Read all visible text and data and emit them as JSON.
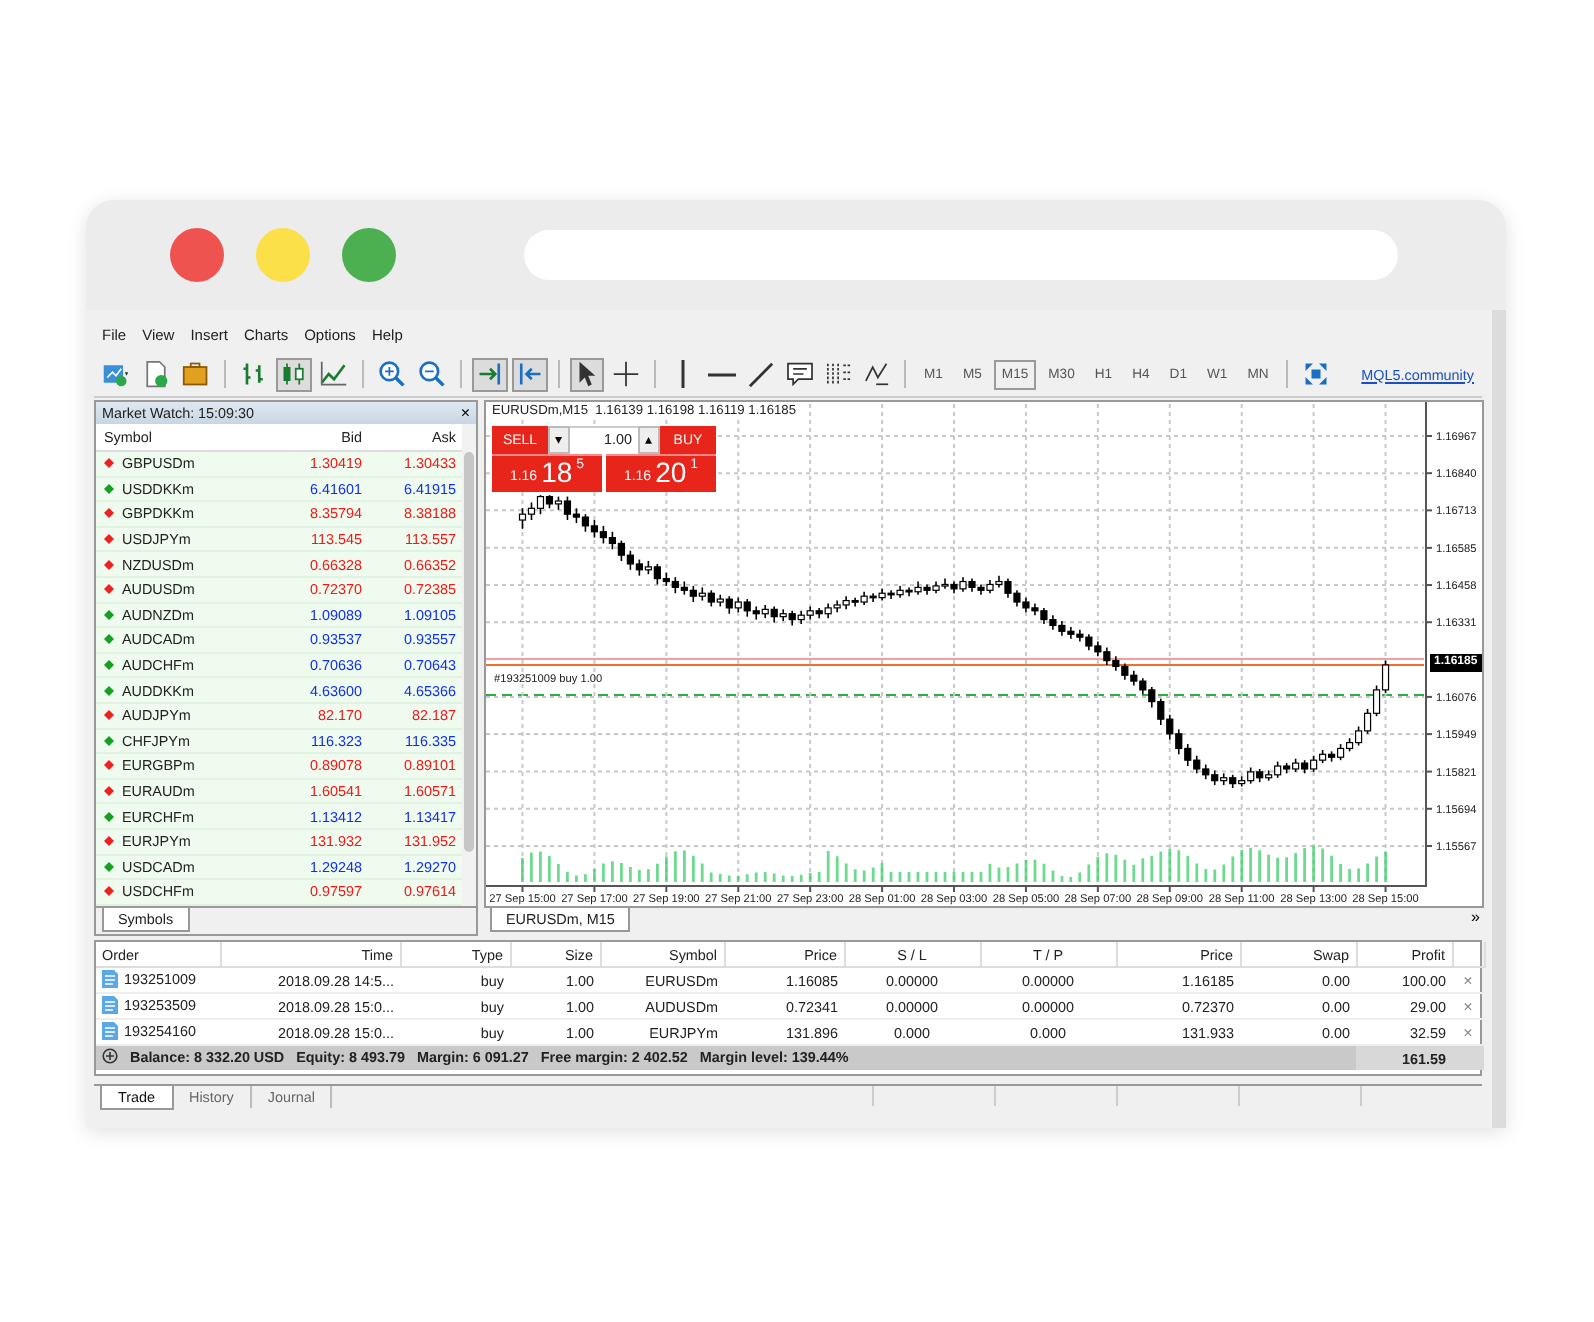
{
  "menu": [
    "File",
    "View",
    "Insert",
    "Charts",
    "Options",
    "Help"
  ],
  "toolbar": {
    "tool_groups": [
      [
        {
          "kind": "new-chart",
          "pressed": false
        },
        {
          "kind": "new-doc",
          "pressed": false
        },
        {
          "kind": "briefcase",
          "pressed": false
        }
      ],
      [
        {
          "kind": "bars",
          "pressed": false
        },
        {
          "kind": "candles",
          "pressed": true
        },
        {
          "kind": "line",
          "pressed": false
        }
      ],
      [
        {
          "kind": "zoom-in",
          "pressed": false
        },
        {
          "kind": "zoom-out",
          "pressed": false
        }
      ],
      [
        {
          "kind": "autoscroll",
          "pressed": true
        },
        {
          "kind": "shift",
          "pressed": true
        }
      ],
      [
        {
          "kind": "cursor",
          "pressed": true
        },
        {
          "kind": "crosshair",
          "pressed": false
        }
      ],
      [
        {
          "kind": "vline",
          "pressed": false
        },
        {
          "kind": "hline",
          "pressed": false
        },
        {
          "kind": "trendline",
          "pressed": false
        },
        {
          "kind": "text",
          "pressed": false
        },
        {
          "kind": "fibo",
          "pressed": false
        },
        {
          "kind": "indicators",
          "pressed": false
        }
      ]
    ],
    "timeframes": [
      {
        "label": "M1",
        "selected": false
      },
      {
        "label": "M5",
        "selected": false
      },
      {
        "label": "M15",
        "selected": true
      },
      {
        "label": "M30",
        "selected": false
      },
      {
        "label": "H1",
        "selected": false
      },
      {
        "label": "H4",
        "selected": false
      },
      {
        "label": "D1",
        "selected": false
      },
      {
        "label": "W1",
        "selected": false
      },
      {
        "label": "MN",
        "selected": false
      }
    ],
    "link": "MQL5.community"
  },
  "market_watch": {
    "title": "Market Watch: 15:09:30",
    "close": "×",
    "columns": [
      "Symbol",
      "Bid",
      "Ask"
    ],
    "rows": [
      {
        "symbol": "GBPUSDm",
        "bid": "1.30419",
        "ask": "1.30433",
        "rising": false
      },
      {
        "symbol": "USDDKKm",
        "bid": "6.41601",
        "ask": "6.41915",
        "rising": true
      },
      {
        "symbol": "GBPDKKm",
        "bid": "8.35794",
        "ask": "8.38188",
        "rising": false
      },
      {
        "symbol": "USDJPYm",
        "bid": "113.545",
        "ask": "113.557",
        "rising": false
      },
      {
        "symbol": "NZDUSDm",
        "bid": "0.66328",
        "ask": "0.66352",
        "rising": false
      },
      {
        "symbol": "AUDUSDm",
        "bid": "0.72370",
        "ask": "0.72385",
        "rising": false
      },
      {
        "symbol": "AUDNZDm",
        "bid": "1.09089",
        "ask": "1.09105",
        "rising": true
      },
      {
        "symbol": "AUDCADm",
        "bid": "0.93537",
        "ask": "0.93557",
        "rising": true
      },
      {
        "symbol": "AUDCHFm",
        "bid": "0.70636",
        "ask": "0.70643",
        "rising": true
      },
      {
        "symbol": "AUDDKKm",
        "bid": "4.63600",
        "ask": "4.65366",
        "rising": true
      },
      {
        "symbol": "AUDJPYm",
        "bid": "82.170",
        "ask": "82.187",
        "rising": false
      },
      {
        "symbol": "CHFJPYm",
        "bid": "116.323",
        "ask": "116.335",
        "rising": true
      },
      {
        "symbol": "EURGBPm",
        "bid": "0.89078",
        "ask": "0.89101",
        "rising": false
      },
      {
        "symbol": "EURAUDm",
        "bid": "1.60541",
        "ask": "1.60571",
        "rising": false
      },
      {
        "symbol": "EURCHFm",
        "bid": "1.13412",
        "ask": "1.13417",
        "rising": true
      },
      {
        "symbol": "EURJPYm",
        "bid": "131.932",
        "ask": "131.952",
        "rising": false
      },
      {
        "symbol": "USDCADm",
        "bid": "1.29248",
        "ask": "1.29270",
        "rising": true
      },
      {
        "symbol": "USDCHFm",
        "bid": "0.97597",
        "ask": "0.97614",
        "rising": false
      }
    ],
    "tab": "Symbols"
  },
  "chart": {
    "header": "EURUSDm,M15  1.16139 1.16198 1.16119 1.16185",
    "trade_panel": {
      "sell": "SELL",
      "buy": "BUY",
      "down": "▾",
      "up": "▴",
      "volume": "1.00",
      "sell_price": {
        "base": "1.16",
        "big": "18",
        "small": "5"
      },
      "buy_price": {
        "base": "1.16",
        "big": "20",
        "small": "1"
      }
    },
    "current_price": "1.16185",
    "chart_data": {
      "type": "candlestick",
      "categories": [
        "27 Sep 15:00",
        null,
        null,
        null,
        null,
        null,
        null,
        null,
        "27 Sep 17:00",
        null,
        null,
        null,
        null,
        null,
        null,
        null,
        "27 Sep 19:00",
        null,
        null,
        null,
        null,
        null,
        null,
        null,
        "27 Sep 21:00",
        null,
        null,
        null,
        null,
        null,
        null,
        null,
        "27 Sep 23:00",
        null,
        null,
        null,
        null,
        null,
        null,
        null,
        "28 Sep 01:00",
        null,
        null,
        null,
        null,
        null,
        null,
        null,
        "28 Sep 03:00",
        null,
        null,
        null,
        null,
        null,
        null,
        null,
        "28 Sep 05:00",
        null,
        null,
        null,
        null,
        null,
        null,
        null,
        "28 Sep 07:00",
        null,
        null,
        null,
        null,
        null,
        null,
        null,
        "28 Sep 09:00",
        null,
        null,
        null,
        null,
        null,
        null,
        null,
        "28 Sep 11:00",
        null,
        null,
        null,
        null,
        null,
        null,
        null,
        "28 Sep 13:00",
        null,
        null,
        null,
        null,
        null,
        null,
        null,
        "28 Sep 15:00",
        null,
        null,
        null,
        null
      ],
      "ohlc": [
        [
          1.1668,
          1.1672,
          1.1665,
          1.167
        ],
        [
          1.167,
          1.1674,
          1.1668,
          1.1672
        ],
        [
          1.1672,
          1.16765,
          1.167,
          1.1676
        ],
        [
          1.1676,
          1.16765,
          1.1672,
          1.16735
        ],
        [
          1.16735,
          1.1676,
          1.16715,
          1.16745
        ],
        [
          1.16745,
          1.1676,
          1.1668,
          1.167
        ],
        [
          1.167,
          1.1672,
          1.1667,
          1.1669
        ],
        [
          1.1669,
          1.167,
          1.1664,
          1.1666
        ],
        [
          1.1666,
          1.1668,
          1.1662,
          1.1664
        ],
        [
          1.1664,
          1.1666,
          1.166,
          1.1662
        ],
        [
          1.1662,
          1.1664,
          1.1658,
          1.166
        ],
        [
          1.166,
          1.1661,
          1.1654,
          1.1656
        ],
        [
          1.1656,
          1.16575,
          1.1651,
          1.1653
        ],
        [
          1.1653,
          1.16545,
          1.1649,
          1.1651
        ],
        [
          1.1651,
          1.1654,
          1.16495,
          1.1652
        ],
        [
          1.1652,
          1.1653,
          1.1646,
          1.1648
        ],
        [
          1.1648,
          1.165,
          1.16455,
          1.1647
        ],
        [
          1.1647,
          1.16485,
          1.1643,
          1.1645
        ],
        [
          1.1645,
          1.1647,
          1.16425,
          1.1644
        ],
        [
          1.1644,
          1.16455,
          1.164,
          1.1642
        ],
        [
          1.1642,
          1.1645,
          1.16405,
          1.1643
        ],
        [
          1.1643,
          1.1644,
          1.16385,
          1.164
        ],
        [
          1.164,
          1.16425,
          1.16385,
          1.1641
        ],
        [
          1.1641,
          1.1642,
          1.1636,
          1.1638
        ],
        [
          1.1638,
          1.16415,
          1.16365,
          1.164
        ],
        [
          1.164,
          1.1641,
          1.1635,
          1.1637
        ],
        [
          1.1637,
          1.16385,
          1.1634,
          1.1636
        ],
        [
          1.1636,
          1.1639,
          1.16345,
          1.16375
        ],
        [
          1.16375,
          1.16385,
          1.1633,
          1.1635
        ],
        [
          1.1635,
          1.16375,
          1.16335,
          1.1636
        ],
        [
          1.1636,
          1.1637,
          1.1632,
          1.1634
        ],
        [
          1.1634,
          1.1637,
          1.16325,
          1.16355
        ],
        [
          1.16355,
          1.16385,
          1.1634,
          1.1637
        ],
        [
          1.1637,
          1.1638,
          1.16345,
          1.1636
        ],
        [
          1.1636,
          1.16395,
          1.16345,
          1.1638
        ],
        [
          1.1638,
          1.16405,
          1.16365,
          1.1639
        ],
        [
          1.1639,
          1.1642,
          1.16375,
          1.16405
        ],
        [
          1.16405,
          1.16415,
          1.16385,
          1.164
        ],
        [
          1.164,
          1.16435,
          1.1639,
          1.1642
        ],
        [
          1.1642,
          1.1643,
          1.164,
          1.16415
        ],
        [
          1.16415,
          1.16445,
          1.16405,
          1.1643
        ],
        [
          1.1643,
          1.1644,
          1.1641,
          1.16425
        ],
        [
          1.16425,
          1.16455,
          1.16415,
          1.1644
        ],
        [
          1.1644,
          1.1645,
          1.1642,
          1.16435
        ],
        [
          1.16435,
          1.1647,
          1.16425,
          1.1645
        ],
        [
          1.1645,
          1.1646,
          1.16425,
          1.1644
        ],
        [
          1.1644,
          1.1647,
          1.1643,
          1.16455
        ],
        [
          1.16455,
          1.1648,
          1.16445,
          1.1646
        ],
        [
          1.1646,
          1.1647,
          1.1643,
          1.16445
        ],
        [
          1.16445,
          1.16485,
          1.16435,
          1.1647
        ],
        [
          1.1647,
          1.1648,
          1.16435,
          1.1645
        ],
        [
          1.1645,
          1.1646,
          1.16425,
          1.1644
        ],
        [
          1.1644,
          1.16475,
          1.1643,
          1.1646
        ],
        [
          1.1646,
          1.1649,
          1.1645,
          1.1647
        ],
        [
          1.1647,
          1.1648,
          1.16415,
          1.1643
        ],
        [
          1.1643,
          1.1644,
          1.16385,
          1.164
        ],
        [
          1.164,
          1.16415,
          1.16365,
          1.1638
        ],
        [
          1.1638,
          1.16395,
          1.16355,
          1.1637
        ],
        [
          1.1637,
          1.1638,
          1.16325,
          1.1634
        ],
        [
          1.1634,
          1.16355,
          1.16305,
          1.1632
        ],
        [
          1.1632,
          1.16335,
          1.16285,
          1.163
        ],
        [
          1.163,
          1.16315,
          1.16275,
          1.1629
        ],
        [
          1.1629,
          1.16305,
          1.16265,
          1.1628
        ],
        [
          1.1628,
          1.1629,
          1.16235,
          1.1625
        ],
        [
          1.1625,
          1.16265,
          1.16215,
          1.1623
        ],
        [
          1.1623,
          1.16245,
          1.16185,
          1.162
        ],
        [
          1.162,
          1.16215,
          1.16165,
          1.1618
        ],
        [
          1.1618,
          1.1619,
          1.16135,
          1.1615
        ],
        [
          1.1615,
          1.16165,
          1.16115,
          1.1613
        ],
        [
          1.1613,
          1.1614,
          1.16085,
          1.161
        ],
        [
          1.161,
          1.1611,
          1.1604,
          1.1606
        ],
        [
          1.1606,
          1.1607,
          1.1598,
          1.16
        ],
        [
          1.16,
          1.16015,
          1.1593,
          1.1595
        ],
        [
          1.1595,
          1.15965,
          1.1588,
          1.159
        ],
        [
          1.159,
          1.15915,
          1.1584,
          1.1586
        ],
        [
          1.1586,
          1.15875,
          1.15815,
          1.1583
        ],
        [
          1.1583,
          1.15845,
          1.15795,
          1.1581
        ],
        [
          1.1581,
          1.15825,
          1.15775,
          1.1579
        ],
        [
          1.1579,
          1.15815,
          1.15775,
          1.158
        ],
        [
          1.158,
          1.1581,
          1.15765,
          1.1578
        ],
        [
          1.1578,
          1.15805,
          1.1577,
          1.1579
        ],
        [
          1.1579,
          1.15835,
          1.1578,
          1.1582
        ],
        [
          1.1582,
          1.1583,
          1.15785,
          1.158
        ],
        [
          1.158,
          1.15825,
          1.1579,
          1.1581
        ],
        [
          1.1581,
          1.15855,
          1.158,
          1.1584
        ],
        [
          1.1584,
          1.1585,
          1.15815,
          1.1583
        ],
        [
          1.1583,
          1.15865,
          1.1582,
          1.1585
        ],
        [
          1.1585,
          1.1586,
          1.15815,
          1.1583
        ],
        [
          1.1583,
          1.15875,
          1.1582,
          1.1586
        ],
        [
          1.1586,
          1.15895,
          1.1585,
          1.1588
        ],
        [
          1.1588,
          1.1589,
          1.15855,
          1.1587
        ],
        [
          1.1587,
          1.15915,
          1.1586,
          1.159
        ],
        [
          1.159,
          1.15935,
          1.1589,
          1.1592
        ],
        [
          1.1592,
          1.15975,
          1.1591,
          1.1596
        ],
        [
          1.1596,
          1.16035,
          1.1595,
          1.1602
        ],
        [
          1.1602,
          1.16115,
          1.1601,
          1.161
        ],
        [
          1.161,
          1.162,
          1.1609,
          1.16185
        ],
        null,
        null,
        null,
        null
      ],
      "grid": true,
      "ylim": [
        1.15444,
        1.17083
      ],
      "yticks": [
        {
          "value": 1.16967,
          "label": "1.16967"
        },
        {
          "value": 1.1684,
          "label": "1.16840"
        },
        {
          "value": 1.16713,
          "label": "1.16713"
        },
        {
          "value": 1.16585,
          "label": "1.16585"
        },
        {
          "value": 1.16458,
          "label": "1.16458"
        },
        {
          "value": 1.16331,
          "label": "1.16331"
        },
        {
          "value": 1.16076,
          "label": "1.16076"
        },
        {
          "value": 1.15949,
          "label": "1.15949"
        },
        {
          "value": 1.15821,
          "label": "1.15821"
        },
        {
          "value": 1.15694,
          "label": "1.15694"
        },
        {
          "value": 1.15567,
          "label": "1.15567"
        }
      ],
      "ylabel": null
    },
    "order_label": "#193251009 buy 1.00",
    "tab": "EURUSDm, M15",
    "scroll_arrow": "»"
  },
  "trade": {
    "columns": [
      "Order",
      "Time",
      "Type",
      "Size",
      "Symbol",
      "Price",
      "S / L",
      "T / P",
      "Price",
      "Swap",
      "Profit"
    ],
    "rows": [
      {
        "cells": [
          "193251009",
          "2018.09.28 14:5...",
          "buy",
          "1.00",
          "EURUSDm",
          "1.16085",
          "0.00000",
          "0.00000",
          "1.16185",
          "0.00",
          "100.00"
        ],
        "close": "×"
      },
      {
        "cells": [
          "193253509",
          "2018.09.28 15:0...",
          "buy",
          "1.00",
          "AUDUSDm",
          "0.72341",
          "0.00000",
          "0.00000",
          "0.72370",
          "0.00",
          "29.00"
        ],
        "close": "×"
      },
      {
        "cells": [
          "193254160",
          "2018.09.28 15:0...",
          "buy",
          "1.00",
          "EURJPYm",
          "131.896",
          "0.000",
          "0.000",
          "131.933",
          "0.00",
          "32.59"
        ],
        "close": "×"
      }
    ],
    "summary": [
      "Balance: 8 332.20 USD",
      "Equity: 8 493.79",
      "Margin: 6 091.27",
      "Free margin: 2 402.52",
      "Margin level: 139.44%"
    ],
    "total": "161.59"
  },
  "bottom_tabs": [
    {
      "label": "Trade",
      "selected": true
    },
    {
      "label": "History",
      "selected": false
    },
    {
      "label": "Journal",
      "selected": false
    }
  ]
}
